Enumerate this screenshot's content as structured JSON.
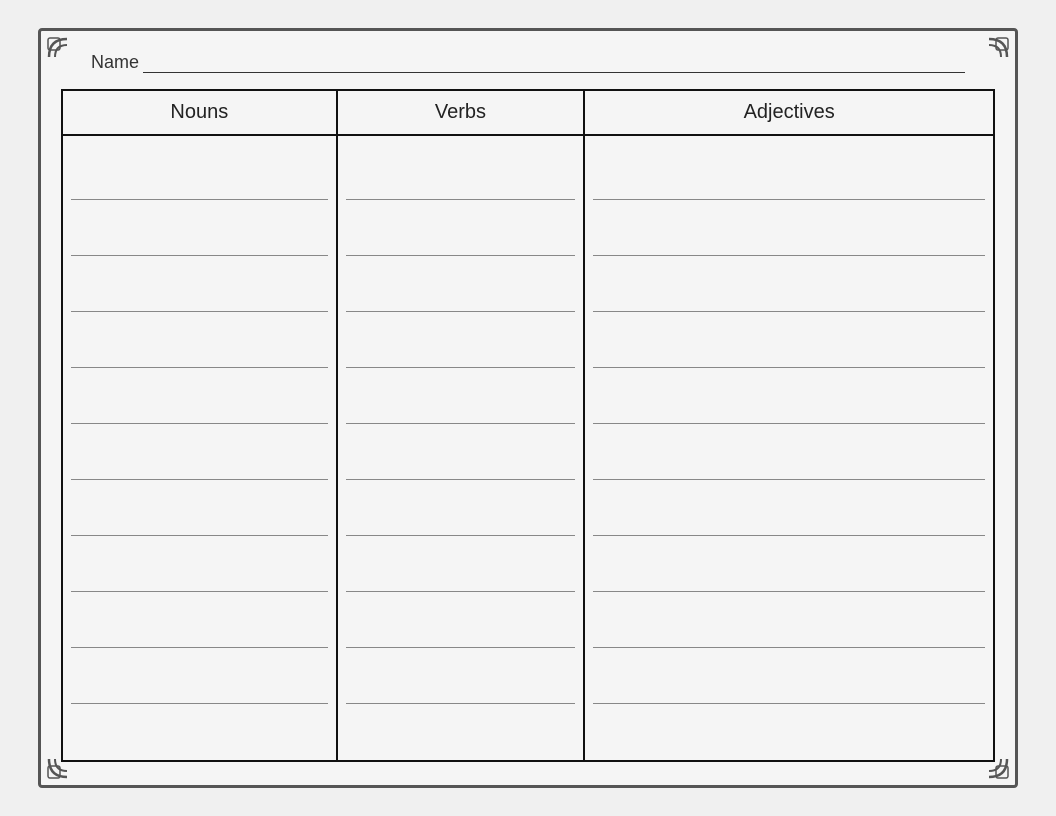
{
  "page": {
    "name_label": "Name",
    "name_placeholder": "_______________________________________________"
  },
  "table": {
    "columns": [
      "Nouns",
      "Verbs",
      "Adjectives"
    ],
    "rows_per_column": 11
  }
}
